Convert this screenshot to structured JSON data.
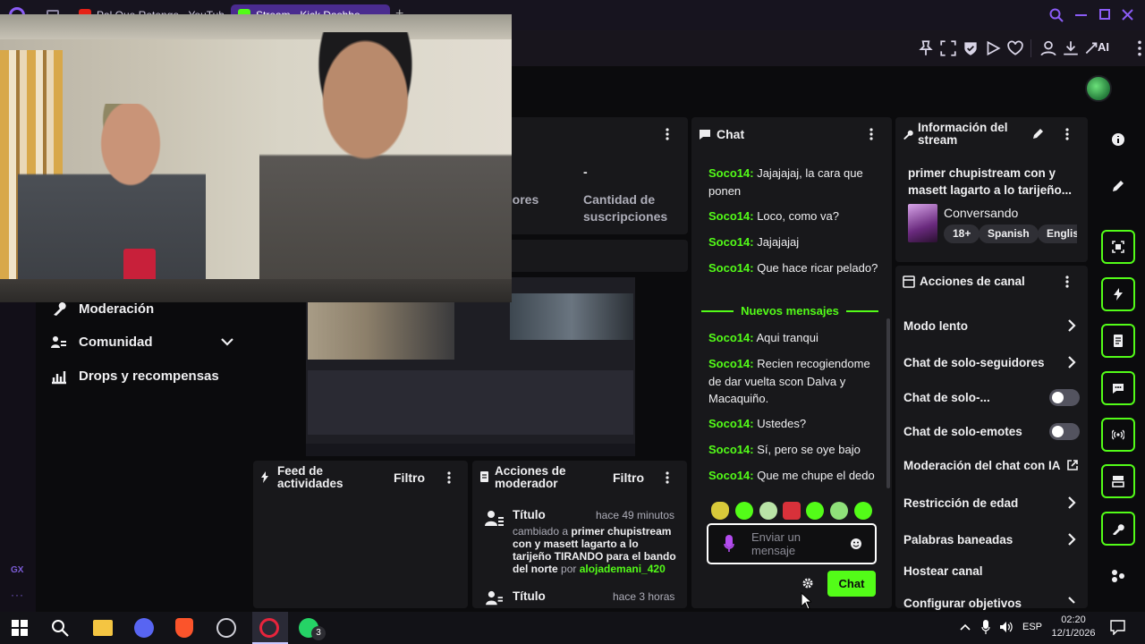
{
  "browser": {
    "tabs": [
      {
        "label": "Pal Que Retengo - YouTube"
      },
      {
        "label": "Stream - Kick Dashbo"
      }
    ]
  },
  "stats": {
    "followers_label": "Seguidores",
    "subs_value": "-",
    "subs_label": "Cantidad de suscripciones"
  },
  "sidebar": {
    "items": [
      {
        "label": "Moderación",
        "icon": "wrench-icon"
      },
      {
        "label": "Comunidad",
        "icon": "community-icon"
      },
      {
        "label": "Drops y recompensas",
        "icon": "drops-icon"
      }
    ]
  },
  "chat": {
    "title": "Chat",
    "messages_before": [
      {
        "user": "Soco14:",
        "text": "Jajajajaj, la cara que ponen"
      },
      {
        "user": "Soco14:",
        "text": "Loco, como va?"
      },
      {
        "user": "Soco14:",
        "text": "Jajajajaj"
      },
      {
        "user": "Soco14:",
        "text": "Que hace ricar pelado?"
      }
    ],
    "new_messages_label": "Nuevos mensajes",
    "messages_after": [
      {
        "user": "Soco14:",
        "text": "Aqui tranqui"
      },
      {
        "user": "Soco14:",
        "text": "Recien recogiendome de dar vuelta scon Dalva y Macaquiño."
      },
      {
        "user": "Soco14:",
        "text": "Ustedes?"
      },
      {
        "user": "Soco14:",
        "text": "Sí, pero se oye bajo"
      },
      {
        "user": "Soco14:",
        "text": "Que me chupe el dedo"
      }
    ],
    "input_placeholder": "Enviar un mensaje",
    "send_label": "Chat"
  },
  "stream_info": {
    "title": "Información del stream",
    "stream_title": "primer chupistream con y masett lagarto a lo tarijeño...",
    "category": "Conversando",
    "tags": [
      "18+",
      "Spanish",
      "Englis"
    ]
  },
  "channel_actions": {
    "title": "Acciones de canal",
    "items": [
      {
        "label": "Modo lento",
        "control": "chevron"
      },
      {
        "label": "Chat de solo-seguidores",
        "control": "chevron"
      },
      {
        "label": "Chat de solo-...",
        "control": "toggle",
        "on": false
      },
      {
        "label": "Chat de solo-emotes",
        "control": "toggle",
        "on": false
      },
      {
        "label": "Moderación del chat con IA",
        "control": "external"
      },
      {
        "label": "Restricción de edad",
        "control": "chevron"
      },
      {
        "label": "Palabras baneadas",
        "control": "chevron"
      },
      {
        "label": "Hostear canal",
        "control": "none"
      },
      {
        "label": "Configurar objetivos",
        "control": "chevron"
      }
    ]
  },
  "activity_feed": {
    "title": "Feed de actividades",
    "filter_label": "Filtro"
  },
  "mod_actions": {
    "title": "Acciones de moderador",
    "filter_label": "Filtro",
    "entries": [
      {
        "heading": "Título",
        "time": "hace 49 minutos",
        "text_prefix": "cambiado a ",
        "text_value": "primer chupistream con y masett lagarto a lo tarijeño TIRANDO para el bando del norte",
        "by_prefix": "por ",
        "by_user": "alojademani_420"
      },
      {
        "heading": "Título",
        "time": "hace 3 horas"
      }
    ]
  },
  "gx_rail": {
    "label": "GX"
  },
  "toolbar": {
    "ai_label": "AI"
  },
  "taskbar": {
    "lang": "ESP",
    "time": "02:20",
    "date": "12/1/2026",
    "whatsapp_badge": "3"
  },
  "colors": {
    "accent": "#53fc18",
    "panel": "#18181b",
    "background": "#0b0b0d"
  }
}
